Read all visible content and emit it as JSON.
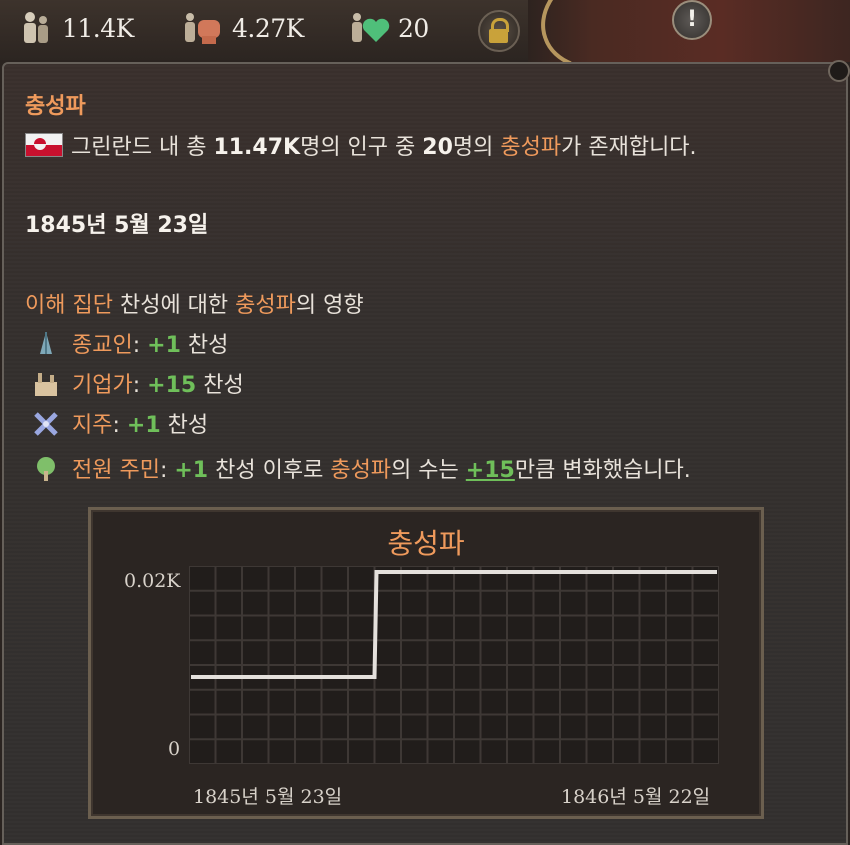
{
  "topbar": {
    "population": "11.4K",
    "military": "4.27K",
    "loyalists": "20"
  },
  "tooltip": {
    "title": "충성파",
    "summary": {
      "region": "그린란드",
      "text_a": " 내 총 ",
      "total": "11.47K",
      "text_b": "명의 인구 중 ",
      "count": "20",
      "text_c": "명의 ",
      "group": "충성파",
      "text_d": "가 존재합니다."
    },
    "date": "1845년 5월 23일",
    "influence_header": {
      "part1": "이해 집단",
      "part2": " 찬성에 대한 ",
      "part3": "충성파",
      "part4": "의 영향"
    },
    "items": [
      {
        "icon": "praying-hands-icon",
        "name": "종교인",
        "value": "+1",
        "suffix": "찬성",
        "tail_a": "",
        "tail_b": "",
        "tail_c": "",
        "tail_d": ""
      },
      {
        "icon": "factory-icon",
        "name": "기업가",
        "value": "+15",
        "suffix": "찬성",
        "tail_a": "",
        "tail_b": "",
        "tail_c": "",
        "tail_d": ""
      },
      {
        "icon": "windmill-icon",
        "name": "지주",
        "value": "+1",
        "suffix": "찬성",
        "tail_a": "",
        "tail_b": "",
        "tail_c": "",
        "tail_d": ""
      },
      {
        "icon": "tree-icon",
        "name": "전원 주민",
        "value": "+1",
        "suffix": "찬성",
        "tail_a": " 이후로 ",
        "tail_b": "충성파",
        "tail_c": "의 수는 ",
        "tail_d": "+15",
        "tail_e": "만큼 변화했습니다."
      }
    ]
  },
  "colors": {
    "accent_orange": "#ef9a5c",
    "positive_green": "#6fbf5a"
  },
  "chart_data": {
    "type": "line",
    "title": "충성파",
    "x_labels": [
      "1845년 5월 23일",
      "1846년 5월 22일"
    ],
    "y_tick_labels": [
      "0.02K",
      "0"
    ],
    "series": [
      {
        "values": [
          5,
          5,
          5,
          5,
          5,
          20,
          20,
          20,
          20,
          20,
          20,
          20,
          20,
          20,
          20
        ]
      }
    ],
    "step_after_fraction": 0.35,
    "ylim": [
      0,
      20
    ],
    "grid": true
  }
}
